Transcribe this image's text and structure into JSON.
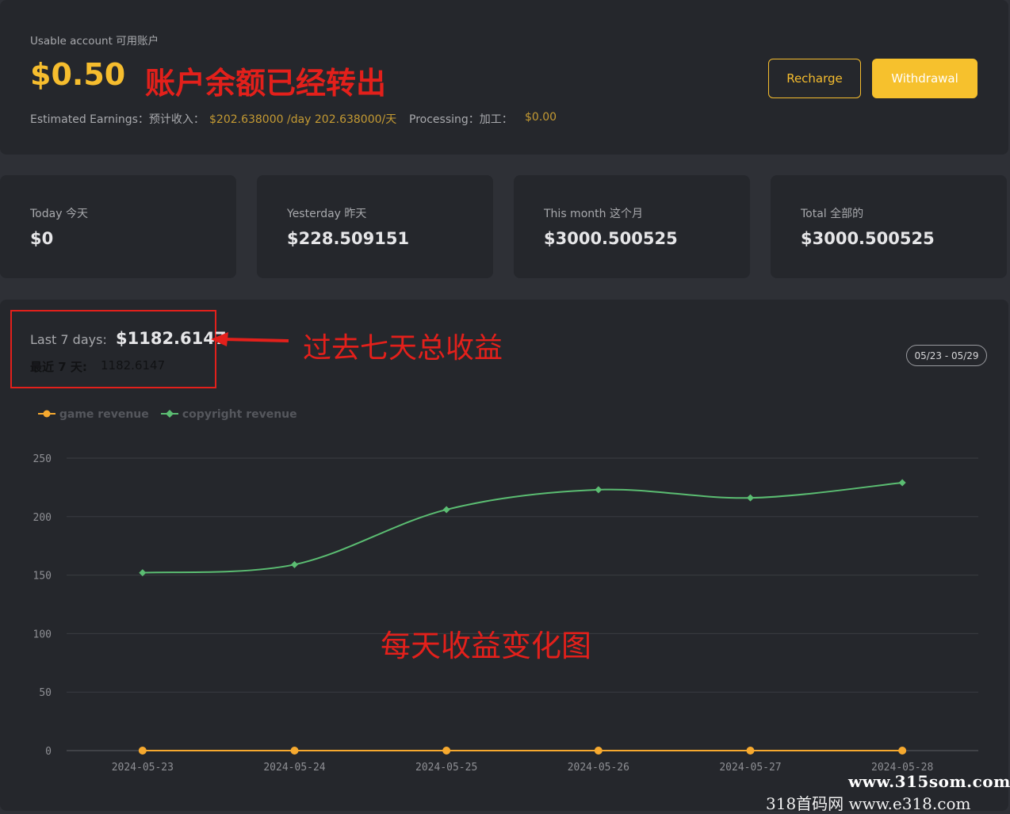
{
  "account": {
    "usable_label": "Usable account 可用账户",
    "balance": "$0.50",
    "annotation": "账户余额已经转出",
    "recharge_label": "Recharge",
    "withdrawal_label": "Withdrawal",
    "estimated_label": "Estimated Earnings：预计收入：",
    "estimated_value": "$202.638000 /day 202.638000/天",
    "processing_label": "Processing：加工：",
    "processing_value": "$0.00",
    "accent_color": "#f6bd2e"
  },
  "stats": [
    {
      "label": "Today 今天",
      "value": "$0"
    },
    {
      "label": "Yesterday 昨天",
      "value": "$228.509151"
    },
    {
      "label": "This month 这个月",
      "value": "$3000.500525"
    },
    {
      "label": "Total 全部的",
      "value": "$3000.500525"
    }
  ],
  "summary": {
    "last7_label": "Last 7 days:",
    "last7_value": "$1182.6147",
    "last7_cn_label": "最近 7 天:",
    "last7_cn_value": "1182.6147",
    "arrow_annotation": "过去七天总收益",
    "chart_annotation": "每天收益变化图",
    "date_range": "05/23 - 05/29"
  },
  "chart_data": {
    "type": "line",
    "title": "",
    "xlabel": "",
    "ylabel": "",
    "categories": [
      "2024-05-23",
      "2024-05-24",
      "2024-05-25",
      "2024-05-26",
      "2024-05-27",
      "2024-05-28"
    ],
    "ylim": [
      0,
      250
    ],
    "yticks": [
      0,
      50,
      100,
      150,
      200,
      250
    ],
    "grid": true,
    "legend_position": "top-left",
    "series": [
      {
        "name": "game revenue",
        "color": "#f6a92f",
        "values": [
          0,
          0,
          0,
          0,
          0,
          0
        ]
      },
      {
        "name": "copyright revenue",
        "color": "#5bbd72",
        "values": [
          152,
          159,
          206,
          223,
          216,
          229
        ]
      }
    ]
  },
  "watermark": {
    "line1": "www.315som.com",
    "line2": "318首码网 www.e318.com"
  }
}
